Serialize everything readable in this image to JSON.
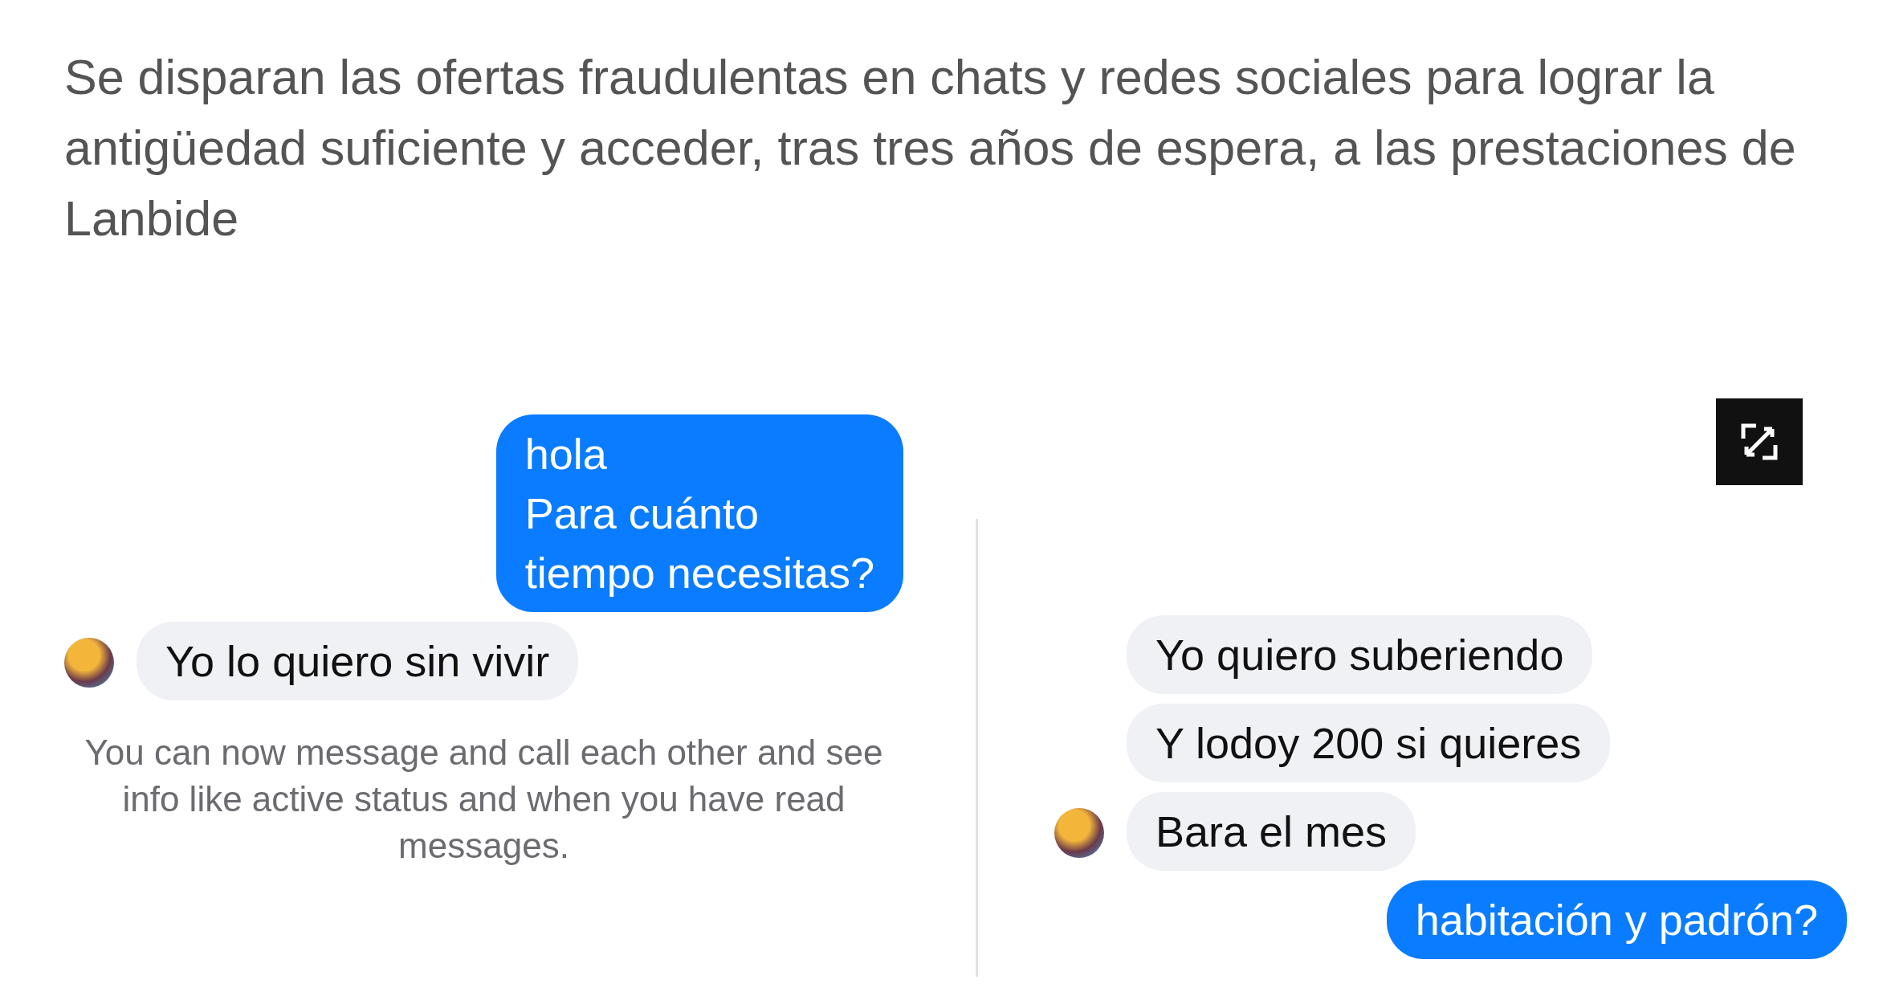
{
  "article": {
    "subtitle": "Se disparan las ofertas fraudulentas en chats y redes sociales para lograr la antigüedad suficiente y acceder, tras tres años de espera, a las prestaciones de Lanbide"
  },
  "left_chat": {
    "messages": [
      {
        "kind": "outgoing",
        "text": "hola\nPara cuánto\ntiempo necesitas?"
      },
      {
        "kind": "incoming",
        "text": "Yo lo quiero sin vivir",
        "avatar": true
      }
    ],
    "notice": "You can now message and call each other and see info like active status and when you have read messages."
  },
  "right_chat": {
    "messages": [
      {
        "kind": "incoming",
        "text": "Yo quiero suberiendo",
        "avatar": false
      },
      {
        "kind": "incoming",
        "text": "Y lodoy 200 si quieres",
        "avatar": false
      },
      {
        "kind": "incoming",
        "text": "Bara el mes",
        "avatar": true
      },
      {
        "kind": "outgoing",
        "text": "habitación y padrón?"
      }
    ]
  }
}
